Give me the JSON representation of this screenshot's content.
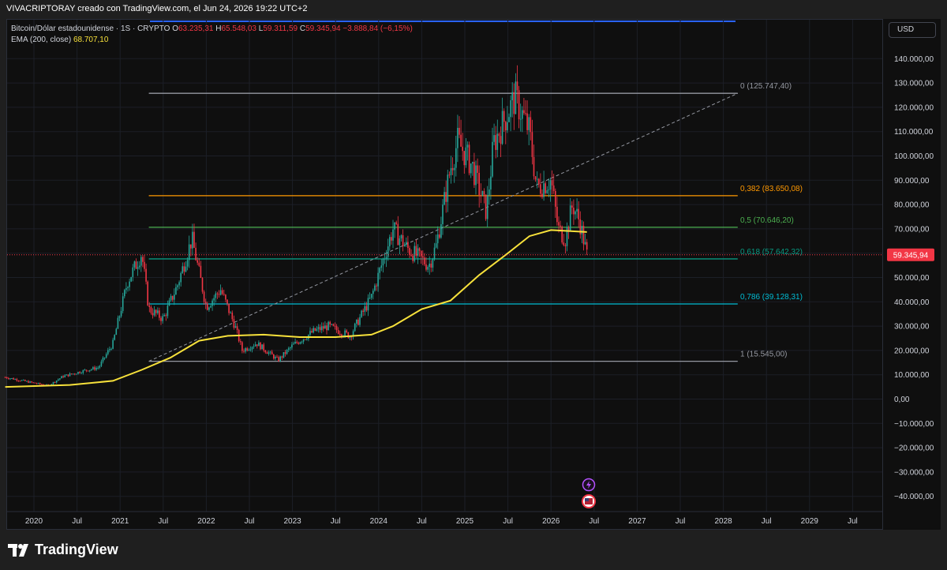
{
  "header": {
    "watermark": "VIVACRIPTORAY creado con TradingView.com, el Jun 24, 2026 19:22 UTC+2"
  },
  "legend": {
    "symbol": "Bitcoin/Dólar estadounidense · 1S · CRYPTO",
    "open_label": "O",
    "open": "63.235,31",
    "high_label": "H",
    "high": "65.548,03",
    "low_label": "L",
    "low": "59.311,59",
    "close_label": "C",
    "close": "59.345,94",
    "change": "−3.888,84 (−6,15%)",
    "ema_label": "EMA (200, close)",
    "ema_value": "68.707,10"
  },
  "currency_button": "USD",
  "brand": "TradingView",
  "icons": [
    "lightning-icon",
    "us-flag-icon",
    "tradingview-logo-icon"
  ],
  "colors": {
    "background": "#0f0f0f",
    "up": "#26a69a",
    "down": "#f23645",
    "ema": "#f7e13b",
    "fib_0": "#9598a1",
    "fib_0382": "#ff9800",
    "fib_05": "#4caf50",
    "fib_0618": "#089981",
    "fib_0786": "#00bcd4",
    "fib_1": "#9598a1",
    "last_price_bg": "#f23645",
    "top_line": "#2962ff"
  },
  "chart_data": {
    "type": "candlestick",
    "title": "Bitcoin/Dólar estadounidense",
    "interval": "1S",
    "x_ticks": [
      "2020",
      "Jul",
      "2021",
      "Jul",
      "2022",
      "Jul",
      "2023",
      "Jul",
      "2024",
      "Jul",
      "2025",
      "Jul",
      "2026",
      "Jul",
      "2027",
      "Jul",
      "2028",
      "Jul",
      "2029",
      "Jul"
    ],
    "x_tick_dates": [
      "2020-01",
      "2020-07",
      "2021-01",
      "2021-07",
      "2022-01",
      "2022-07",
      "2023-01",
      "2023-07",
      "2024-01",
      "2024-07",
      "2025-01",
      "2025-07",
      "2026-01",
      "2026-07",
      "2027-01",
      "2027-07",
      "2028-01",
      "2028-07",
      "2029-01",
      "2029-07"
    ],
    "y_ticks": [
      140000,
      130000,
      120000,
      110000,
      100000,
      90000,
      80000,
      70000,
      60000,
      50000,
      40000,
      30000,
      20000,
      10000,
      0,
      -10000,
      -20000,
      -30000,
      -40000
    ],
    "y_tick_labels": [
      "140.000,00",
      "130.000,00",
      "120.000,00",
      "110.000,00",
      "100.000,00",
      "90.000,00",
      "80.000,00",
      "70.000,00",
      "60.000,00",
      "50.000,00",
      "40.000,00",
      "30.000,00",
      "20.000,00",
      "10.000,00",
      "0,00",
      "−10.000,00",
      "−20.000,00",
      "−30.000,00",
      "−40.000,00"
    ],
    "ylim": [
      -45000,
      150000
    ],
    "last_price": 59345.94,
    "last_price_label": "59.345,94",
    "price_path": [
      [
        "2019-09",
        9000
      ],
      [
        "2019-12",
        7200
      ],
      [
        "2020-03",
        5500
      ],
      [
        "2020-05",
        9300
      ],
      [
        "2020-08",
        11700
      ],
      [
        "2020-10",
        13000
      ],
      [
        "2020-12",
        23000
      ],
      [
        "2021-02",
        48000
      ],
      [
        "2021-04",
        60000
      ],
      [
        "2021-05",
        37000
      ],
      [
        "2021-07",
        33000
      ],
      [
        "2021-09",
        47000
      ],
      [
        "2021-11",
        66000
      ],
      [
        "2022-01",
        38000
      ],
      [
        "2022-03",
        45000
      ],
      [
        "2022-05",
        30000
      ],
      [
        "2022-06",
        20000
      ],
      [
        "2022-08",
        23000
      ],
      [
        "2022-11",
        16000
      ],
      [
        "2023-01",
        22000
      ],
      [
        "2023-04",
        28000
      ],
      [
        "2023-06",
        30000
      ],
      [
        "2023-09",
        26000
      ],
      [
        "2023-12",
        42000
      ],
      [
        "2024-03",
        70000
      ],
      [
        "2024-05",
        62000
      ],
      [
        "2024-08",
        55000
      ],
      [
        "2024-09",
        63000
      ],
      [
        "2024-11",
        95000
      ],
      [
        "2024-12",
        106000
      ],
      [
        "2025-02",
        96000
      ],
      [
        "2025-04",
        77000
      ],
      [
        "2025-05",
        105000
      ],
      [
        "2025-07",
        118000
      ],
      [
        "2025-08",
        124000
      ],
      [
        "2025-10",
        110000
      ],
      [
        "2025-11",
        87000
      ],
      [
        "2026-01",
        90000
      ],
      [
        "2026-02",
        70000
      ],
      [
        "2026-03",
        66000
      ],
      [
        "2026-04",
        80000
      ],
      [
        "2026-05",
        73000
      ],
      [
        "2026-06",
        59345
      ]
    ],
    "ema_path": [
      [
        "2019-09",
        5000
      ],
      [
        "2020-06",
        5800
      ],
      [
        "2020-12",
        7500
      ],
      [
        "2021-04",
        12000
      ],
      [
        "2021-08",
        17000
      ],
      [
        "2021-12",
        24000
      ],
      [
        "2022-04",
        26000
      ],
      [
        "2022-09",
        26500
      ],
      [
        "2023-02",
        25500
      ],
      [
        "2023-07",
        25500
      ],
      [
        "2023-12",
        26500
      ],
      [
        "2024-03",
        30000
      ],
      [
        "2024-07",
        37000
      ],
      [
        "2024-11",
        40500
      ],
      [
        "2025-03",
        51000
      ],
      [
        "2025-07",
        60000
      ],
      [
        "2025-10",
        67000
      ],
      [
        "2026-01",
        69500
      ],
      [
        "2026-06",
        68707
      ]
    ],
    "fib_levels": [
      {
        "ratio": "0",
        "price": 125747.4,
        "label": "0 (125.747,40)"
      },
      {
        "ratio": "0,382",
        "price": 83650.08,
        "label": "0,382 (83.650,08)"
      },
      {
        "ratio": "0,5",
        "price": 70646.2,
        "label": "0,5 (70.646,20)"
      },
      {
        "ratio": "0,618",
        "price": 57642.32,
        "label": "0,618 (57.642,32)"
      },
      {
        "ratio": "0,786",
        "price": 39128.31,
        "label": "0,786 (39.128,31)"
      },
      {
        "ratio": "1",
        "price": 15545.0,
        "label": "1 (15.545,00)"
      }
    ],
    "fib_range": {
      "start": "2021-05",
      "end": "2028-03"
    },
    "trend_line": {
      "from": [
        "2021-05",
        15545
      ],
      "to": [
        "2028-03",
        125747
      ]
    },
    "grid": true
  }
}
